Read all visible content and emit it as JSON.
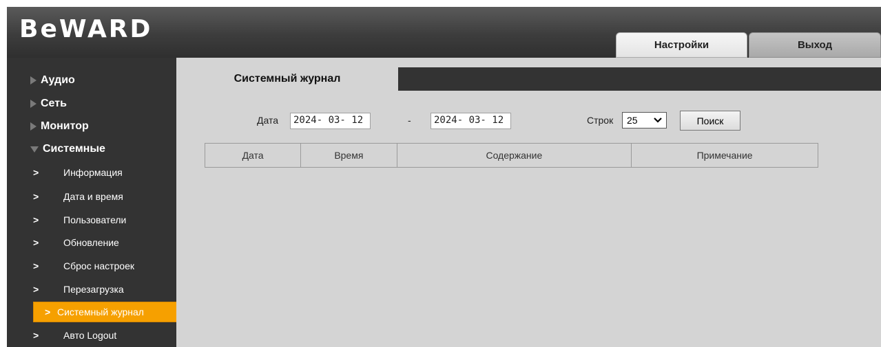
{
  "header": {
    "logo": "BeWARD",
    "tabs": {
      "settings": "Настройки",
      "logout": "Выход"
    }
  },
  "sidebar": {
    "groups": [
      "Аудио",
      "Сеть",
      "Монитор",
      "Системные"
    ],
    "sub_items": [
      "Информация",
      "Дата и время",
      "Пользователи",
      "Обновление",
      "Сброс настроек",
      "Перезагрузка",
      "Системный журнал",
      "Авто Logout"
    ],
    "active_sub_item": "Системный журнал",
    "accent_color": "#f6a000"
  },
  "main": {
    "page_title": "Системный журнал",
    "filter": {
      "date_label": "Дата",
      "date_from": "2024- 03- 12",
      "separator": "-",
      "date_to": "2024- 03- 12",
      "rows_label": "Строк",
      "rows_value": "25",
      "search_button": "Поиск"
    },
    "table": {
      "columns": [
        "Дата",
        "Время",
        "Содержание",
        "Примечание"
      ],
      "rows": []
    }
  }
}
